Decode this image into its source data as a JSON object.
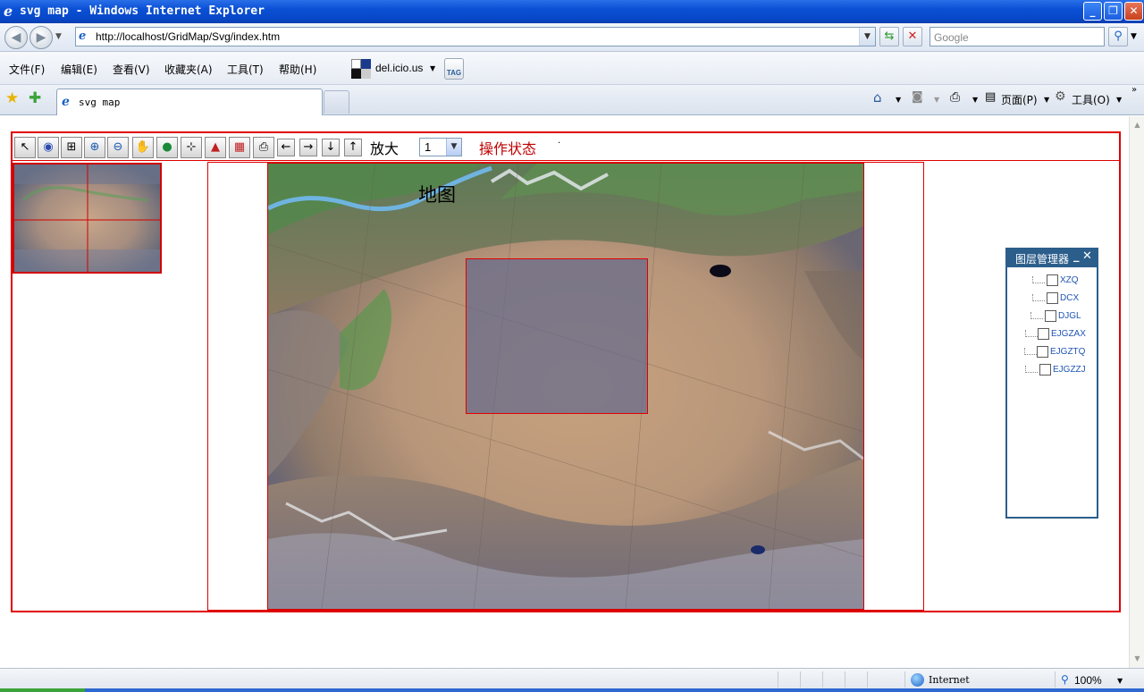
{
  "window": {
    "title": "svg map - Windows Internet Explorer",
    "controls": {
      "minimize": "_",
      "restore": "❐",
      "close": "✕"
    }
  },
  "address_bar": {
    "url": "http://localhost/GridMap/Svg/index.htm",
    "search_placeholder": "Google"
  },
  "menu": {
    "items": [
      "文件(F)",
      "编辑(E)",
      "查看(V)",
      "收藏夹(A)",
      "工具(T)",
      "帮助(H)"
    ],
    "delicious_label": "del.icio.us",
    "tag_label": "TAG"
  },
  "tabs": {
    "active_tab_label": "svg map"
  },
  "command_bar": {
    "page_label": "页面(P)",
    "tools_label": "工具(O)"
  },
  "app": {
    "toolbar": {
      "tools": [
        "select",
        "view",
        "zoom-box",
        "zoom-in",
        "zoom-out",
        "pan",
        "full-extent",
        "measure",
        "chart",
        "report",
        "print",
        "left",
        "right",
        "down",
        "up"
      ],
      "zoom_label": "放大",
      "zoom_value": "1",
      "status_label": "操作状态",
      "status_dot": "·"
    },
    "map": {
      "title": "地图"
    },
    "layer_manager": {
      "title": "图层管理器",
      "minimize": "_",
      "close": "✕",
      "layers": [
        {
          "name": "XZQ",
          "checked": false
        },
        {
          "name": "DCX",
          "checked": false
        },
        {
          "name": "DJGL",
          "checked": false
        },
        {
          "name": "EJGZAX",
          "checked": false
        },
        {
          "name": "EJGZTQ",
          "checked": false
        },
        {
          "name": "EJGZZJ",
          "checked": false
        }
      ]
    }
  },
  "status_bar": {
    "zone": "Internet",
    "zoom": "100%"
  },
  "colors": {
    "frame_red": "#e00000",
    "panel_blue": "#2c5e8c",
    "status_red": "#c00000"
  }
}
